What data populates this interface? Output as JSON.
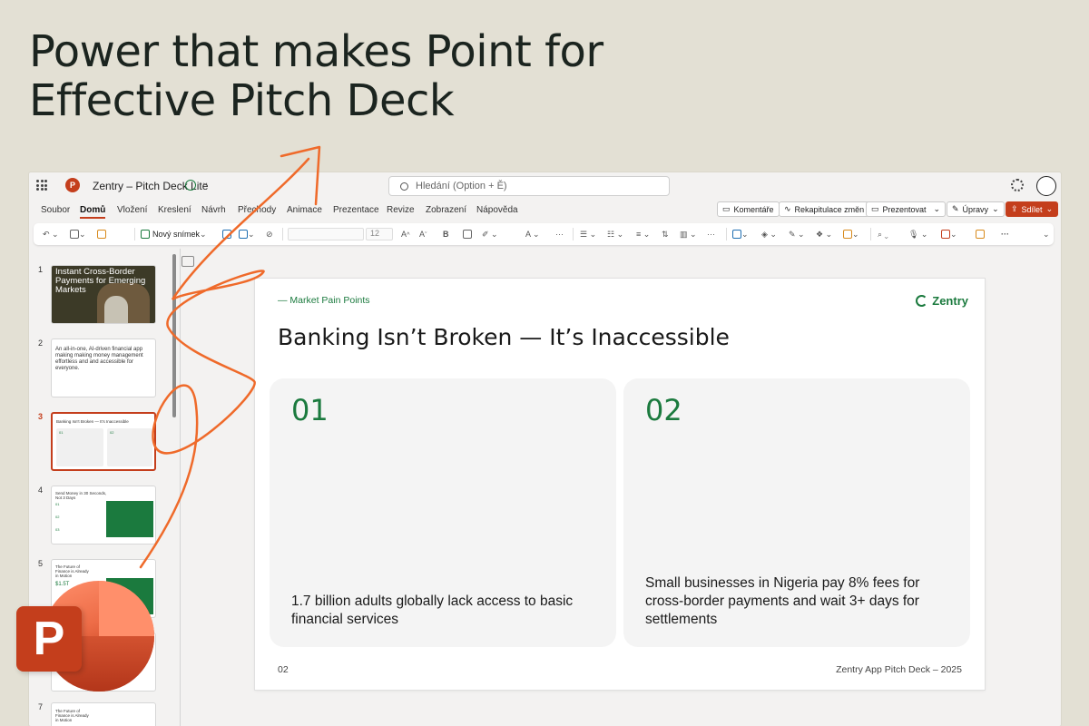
{
  "headline": {
    "line1": "Power that makes Point for",
    "line2": "Effective Pitch Deck"
  },
  "titlebar": {
    "app_initial": "P",
    "doc_title": "Zentry – Pitch Deck Lite",
    "chevron": "⌄",
    "search_placeholder": "Hledání (Option + Ě)"
  },
  "tabs": [
    "Soubor",
    "Domů",
    "Vložení",
    "Kreslení",
    "Návrh",
    "Přechody",
    "Animace",
    "Prezentace",
    "Revize",
    "Zobrazení",
    "Nápověda"
  ],
  "active_tab": "Domů",
  "right_buttons": {
    "comments": "Komentáře",
    "recap": "Rekapitulace změn",
    "present": "Prezentovat",
    "edit": "Úpravy",
    "share": "Sdílet"
  },
  "ribbon": {
    "new_slide": "Nový snímek",
    "font_size": "12",
    "more": "···"
  },
  "thumbnails": [
    {
      "num": "1",
      "title": "Instant Cross-Border Payments for Emerging Markets"
    },
    {
      "num": "2",
      "title": "An all-in-one, AI-driven financial app making making money management effortless and and accessible for everyone."
    },
    {
      "num": "3",
      "title": "Banking Isn't Broken — It's Inaccessible",
      "sub1": "01",
      "sub2": "02"
    },
    {
      "num": "4",
      "title": "Send Money in 30 Seconds, Not 3 Days",
      "sub1": "01",
      "sub2": "02",
      "sub3": "03"
    },
    {
      "num": "5",
      "title": "The Future of Finance is Already in Motion",
      "sub1": "$1.5T"
    },
    {
      "num": "6",
      "title": ""
    },
    {
      "num": "7",
      "title": "The Future of Finance is Already in Motion"
    }
  ],
  "slide": {
    "kicker": "— Market Pain Points",
    "logo": "Zentry",
    "title": "Banking Isn’t Broken — It’s Inaccessible",
    "cards": [
      {
        "num": "01",
        "text": "1.7 billion adults globally lack access to basic financial services"
      },
      {
        "num": "02",
        "text": "Small businesses in Nigeria pay 8% fees for cross-border payments and wait 3+ days for settlements"
      }
    ],
    "footer_left": "02",
    "footer_right": "Zentry App Pitch Deck – 2025"
  },
  "brand": {
    "logo_letter": "P"
  },
  "colors": {
    "background": "#e3e0d4",
    "accent_green": "#1b7a3e",
    "ppt_red": "#c43e1c",
    "arrow_orange": "#ef6a2a"
  }
}
